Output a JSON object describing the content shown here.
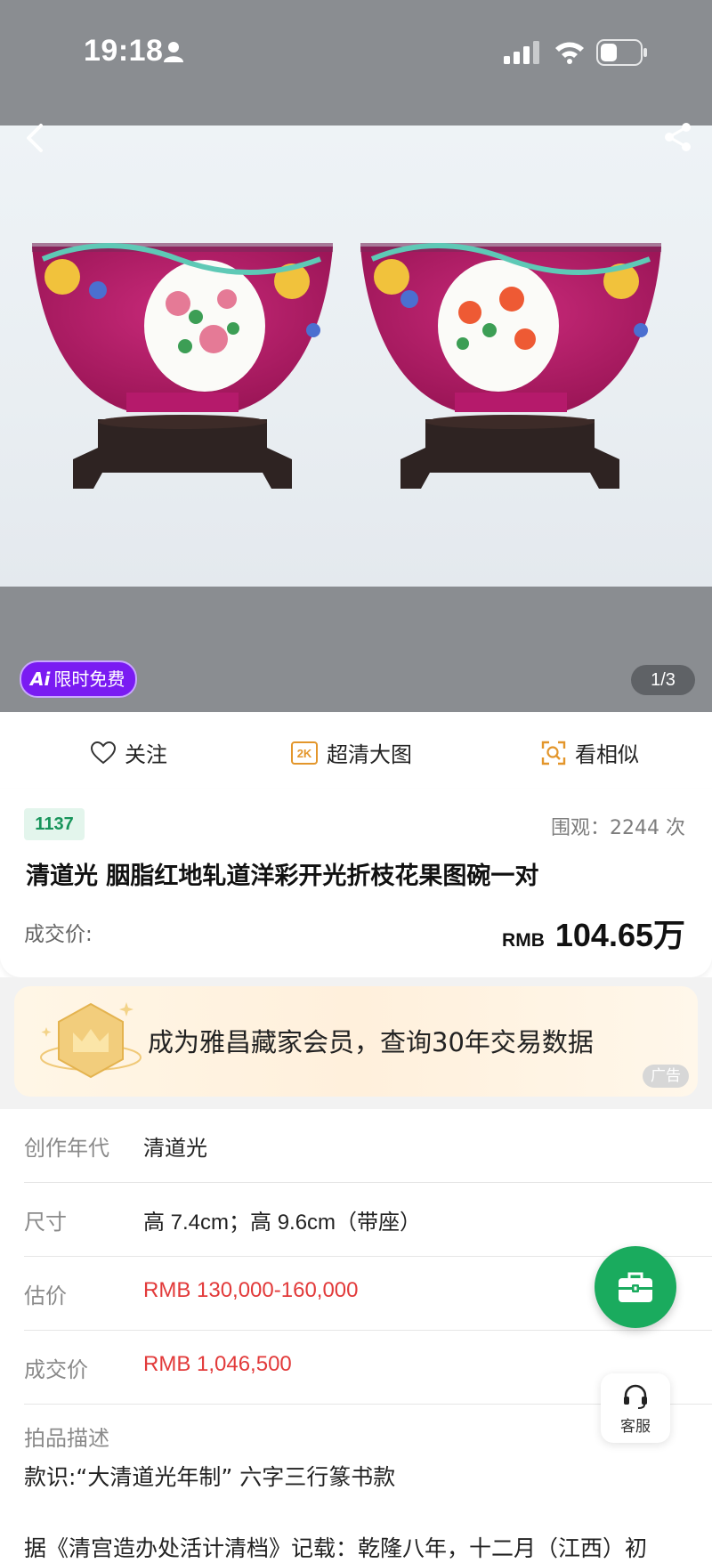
{
  "status_bar": {
    "time": "19:18",
    "icons": [
      "person-icon",
      "signal-icon",
      "wifi-icon",
      "battery-icon"
    ]
  },
  "hero": {
    "ai_badge": {
      "mark": "Ai",
      "label": "限时免费"
    },
    "page_indicator": "1/3"
  },
  "actions": {
    "follow": "关注",
    "hd_image": "超清大图",
    "hd_icon_text": "2K",
    "similar": "看相似"
  },
  "lot": {
    "number": "1137",
    "views": "围观：2244 次",
    "title": "清道光 胭脂红地轧道洋彩开光折枝花果图碗一对",
    "deal_label": "成交价:",
    "deal_currency": "RMB",
    "deal_amount": "104.65万"
  },
  "ad": {
    "text": "成为雅昌藏家会员，查询30年交易数据",
    "tag": "广告"
  },
  "details": [
    {
      "key": "创作年代",
      "value": "清道光"
    },
    {
      "key": "尺寸",
      "value": "高 7.4cm；高 9.6cm（带座）"
    },
    {
      "key": "估价",
      "value": "RMB  130,000-160,000"
    },
    {
      "key": "成交价",
      "value": "RMB 1,046,500"
    }
  ],
  "description": {
    "label": "拍品描述",
    "text": "款识:“大清道光年制” 六字三行篆书款",
    "more": "据《清宫造办处活计清档》记载：乾隆八年，十二月（江西）初"
  },
  "customer_service": "客服",
  "colors": {
    "accent_green": "#1aab5e",
    "price_red": "#e23a3a",
    "ai_purple": "#7a1bf2"
  }
}
